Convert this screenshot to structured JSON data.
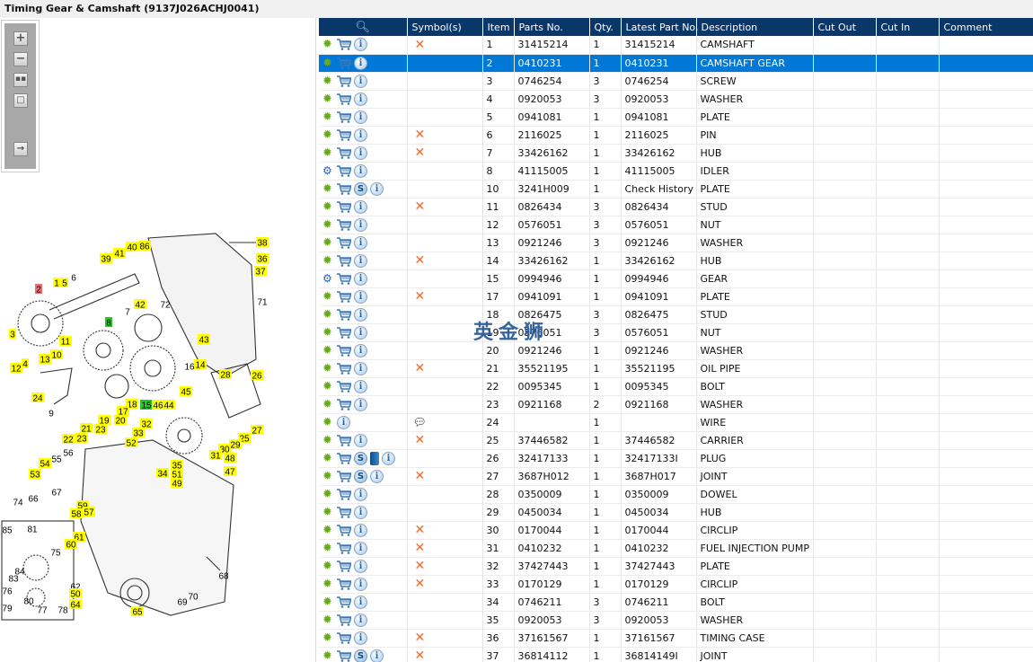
{
  "title": "Timing Gear & Camshaft (9137J026ACHJ0041)",
  "toolbar": {
    "zoom_in": "+",
    "zoom_out": "−"
  },
  "watermark": "英金狮",
  "colors": {
    "header": "#0a3769",
    "selected": "#0078d7",
    "gear": "#6aab1c",
    "x": "#f26a2a"
  },
  "diagram_callouts": [
    "38",
    "36",
    "37",
    "39",
    "41",
    "40",
    "86",
    "2",
    "1",
    "5",
    "6",
    "71",
    "42",
    "7",
    "72",
    "8",
    "3",
    "11",
    "10",
    "13",
    "4",
    "12",
    "43",
    "14",
    "16",
    "28",
    "26",
    "45",
    "24",
    "18",
    "15",
    "46",
    "44",
    "17",
    "19",
    "20",
    "9",
    "21",
    "23",
    "22",
    "23",
    "32",
    "33",
    "27",
    "52",
    "25",
    "29",
    "30",
    "31",
    "48",
    "47",
    "35",
    "51",
    "34",
    "49",
    "55",
    "56",
    "54",
    "53",
    "67",
    "66",
    "74",
    "59",
    "58",
    "57",
    "85",
    "81",
    "61",
    "60",
    "75",
    "84",
    "83",
    "62",
    "50",
    "64",
    "76",
    "80",
    "78",
    "77",
    "79",
    "65",
    "68",
    "70",
    "69"
  ],
  "columns": [
    "Symbol(s)",
    "Item",
    "Parts No.",
    "Qty.",
    "Latest Part No.",
    "Description",
    "Cut Out",
    "Cut In",
    "Comment"
  ],
  "rows": [
    {
      "gear": "green",
      "cart": true,
      "s": false,
      "book": false,
      "sym": "x",
      "item": "1",
      "part": "31415214",
      "qty": "1",
      "latest": "31415214",
      "desc": "CAMSHAFT"
    },
    {
      "gear": "green",
      "cart": true,
      "s": false,
      "book": false,
      "sym": "",
      "item": "2",
      "part": "0410231",
      "qty": "1",
      "latest": "0410231",
      "desc": "CAMSHAFT GEAR",
      "selected": true
    },
    {
      "gear": "green",
      "cart": true,
      "s": false,
      "book": false,
      "sym": "",
      "item": "3",
      "part": "0746254",
      "qty": "3",
      "latest": "0746254",
      "desc": "SCREW"
    },
    {
      "gear": "green",
      "cart": true,
      "s": false,
      "book": false,
      "sym": "",
      "item": "4",
      "part": "0920053",
      "qty": "3",
      "latest": "0920053",
      "desc": "WASHER"
    },
    {
      "gear": "green",
      "cart": true,
      "s": false,
      "book": false,
      "sym": "",
      "item": "5",
      "part": "0941081",
      "qty": "1",
      "latest": "0941081",
      "desc": "PLATE"
    },
    {
      "gear": "green",
      "cart": true,
      "s": false,
      "book": false,
      "sym": "x",
      "item": "6",
      "part": "2116025",
      "qty": "1",
      "latest": "2116025",
      "desc": "PIN"
    },
    {
      "gear": "green",
      "cart": true,
      "s": false,
      "book": false,
      "sym": "x",
      "item": "7",
      "part": "33426162",
      "qty": "1",
      "latest": "33426162",
      "desc": "HUB"
    },
    {
      "gear": "blue",
      "cart": true,
      "s": false,
      "book": false,
      "sym": "",
      "item": "8",
      "part": "41115005",
      "qty": "1",
      "latest": "41115005",
      "desc": "IDLER"
    },
    {
      "gear": "green",
      "cart": true,
      "s": true,
      "book": false,
      "sym": "",
      "item": "10",
      "part": "3241H009",
      "qty": "1",
      "latest": "Check History",
      "desc": "PLATE"
    },
    {
      "gear": "green",
      "cart": true,
      "s": false,
      "book": false,
      "sym": "x",
      "item": "11",
      "part": "0826434",
      "qty": "3",
      "latest": "0826434",
      "desc": "STUD"
    },
    {
      "gear": "green",
      "cart": true,
      "s": false,
      "book": false,
      "sym": "",
      "item": "12",
      "part": "0576051",
      "qty": "3",
      "latest": "0576051",
      "desc": "NUT"
    },
    {
      "gear": "green",
      "cart": true,
      "s": false,
      "book": false,
      "sym": "",
      "item": "13",
      "part": "0921246",
      "qty": "3",
      "latest": "0921246",
      "desc": "WASHER"
    },
    {
      "gear": "green",
      "cart": true,
      "s": false,
      "book": false,
      "sym": "x",
      "item": "14",
      "part": "33426162",
      "qty": "1",
      "latest": "33426162",
      "desc": "HUB"
    },
    {
      "gear": "blue",
      "cart": true,
      "s": false,
      "book": false,
      "sym": "",
      "item": "15",
      "part": "0994946",
      "qty": "1",
      "latest": "0994946",
      "desc": "GEAR"
    },
    {
      "gear": "green",
      "cart": true,
      "s": false,
      "book": false,
      "sym": "x",
      "item": "17",
      "part": "0941091",
      "qty": "1",
      "latest": "0941091",
      "desc": "PLATE"
    },
    {
      "gear": "green",
      "cart": true,
      "s": false,
      "book": false,
      "sym": "",
      "item": "18",
      "part": "0826475",
      "qty": "3",
      "latest": "0826475",
      "desc": "STUD"
    },
    {
      "gear": "green",
      "cart": true,
      "s": false,
      "book": false,
      "sym": "",
      "item": "19",
      "part": "0576051",
      "qty": "3",
      "latest": "0576051",
      "desc": "NUT"
    },
    {
      "gear": "green",
      "cart": true,
      "s": false,
      "book": false,
      "sym": "",
      "item": "20",
      "part": "0921246",
      "qty": "1",
      "latest": "0921246",
      "desc": "WASHER"
    },
    {
      "gear": "green",
      "cart": true,
      "s": false,
      "book": false,
      "sym": "x",
      "item": "21",
      "part": "35521195",
      "qty": "1",
      "latest": "35521195",
      "desc": "OIL PIPE"
    },
    {
      "gear": "green",
      "cart": true,
      "s": false,
      "book": false,
      "sym": "",
      "item": "22",
      "part": "0095345",
      "qty": "1",
      "latest": "0095345",
      "desc": "BOLT"
    },
    {
      "gear": "green",
      "cart": true,
      "s": false,
      "book": false,
      "sym": "",
      "item": "23",
      "part": "0921168",
      "qty": "2",
      "latest": "0921168",
      "desc": "WASHER"
    },
    {
      "gear": "green",
      "cart": false,
      "s": false,
      "book": false,
      "sym": "warn",
      "item": "24",
      "part": "",
      "qty": "1",
      "latest": "",
      "desc": "WIRE"
    },
    {
      "gear": "green",
      "cart": true,
      "s": false,
      "book": false,
      "sym": "x",
      "item": "25",
      "part": "37446582",
      "qty": "1",
      "latest": "37446582",
      "desc": "CARRIER"
    },
    {
      "gear": "green",
      "cart": true,
      "s": true,
      "book": true,
      "sym": "",
      "item": "26",
      "part": "32417133",
      "qty": "1",
      "latest": "32417133I",
      "desc": "PLUG"
    },
    {
      "gear": "green",
      "cart": true,
      "s": true,
      "book": false,
      "sym": "x",
      "item": "27",
      "part": "3687H012",
      "qty": "1",
      "latest": "3687H017",
      "desc": "JOINT"
    },
    {
      "gear": "green",
      "cart": true,
      "s": false,
      "book": false,
      "sym": "",
      "item": "28",
      "part": "0350009",
      "qty": "1",
      "latest": "0350009",
      "desc": "DOWEL"
    },
    {
      "gear": "green",
      "cart": true,
      "s": false,
      "book": false,
      "sym": "",
      "item": "29",
      "part": "0450034",
      "qty": "1",
      "latest": "0450034",
      "desc": "HUB"
    },
    {
      "gear": "green",
      "cart": true,
      "s": false,
      "book": false,
      "sym": "x",
      "item": "30",
      "part": "0170044",
      "qty": "1",
      "latest": "0170044",
      "desc": "CIRCLIP"
    },
    {
      "gear": "green",
      "cart": true,
      "s": false,
      "book": false,
      "sym": "x",
      "item": "31",
      "part": "0410232",
      "qty": "1",
      "latest": "0410232",
      "desc": "FUEL INJECTION PUMP G"
    },
    {
      "gear": "green",
      "cart": true,
      "s": false,
      "book": false,
      "sym": "x",
      "item": "32",
      "part": "37427443",
      "qty": "1",
      "latest": "37427443",
      "desc": "PLATE"
    },
    {
      "gear": "green",
      "cart": true,
      "s": false,
      "book": false,
      "sym": "x",
      "item": "33",
      "part": "0170129",
      "qty": "1",
      "latest": "0170129",
      "desc": "CIRCLIP"
    },
    {
      "gear": "green",
      "cart": true,
      "s": false,
      "book": false,
      "sym": "",
      "item": "34",
      "part": "0746211",
      "qty": "3",
      "latest": "0746211",
      "desc": "BOLT"
    },
    {
      "gear": "green",
      "cart": true,
      "s": false,
      "book": false,
      "sym": "",
      "item": "35",
      "part": "0920053",
      "qty": "3",
      "latest": "0920053",
      "desc": "WASHER"
    },
    {
      "gear": "green",
      "cart": true,
      "s": false,
      "book": false,
      "sym": "x",
      "item": "36",
      "part": "37161567",
      "qty": "1",
      "latest": "37161567",
      "desc": "TIMING CASE"
    },
    {
      "gear": "green",
      "cart": true,
      "s": true,
      "book": false,
      "sym": "x",
      "item": "37",
      "part": "36814112",
      "qty": "1",
      "latest": "36814149I",
      "desc": "JOINT"
    }
  ]
}
